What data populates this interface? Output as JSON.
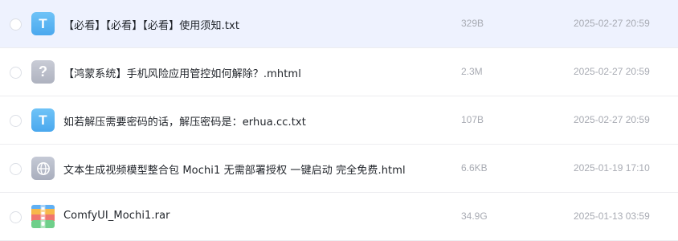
{
  "files": [
    {
      "name": "【必看】【必看】【必看】使用须知.txt",
      "size": "329B",
      "date": "2025-02-27 20:59",
      "icon": "txt-file-icon",
      "icon_glyph": "T",
      "selected": true
    },
    {
      "name": "【鸿蒙系统】手机风险应用管控如何解除？.mhtml",
      "size": "2.3M",
      "date": "2025-02-27 20:59",
      "icon": "unknown-file-icon",
      "icon_glyph": "?",
      "selected": false
    },
    {
      "name": "如若解压需要密码的话，解压密码是：erhua.cc.txt",
      "size": "107B",
      "date": "2025-02-27 20:59",
      "icon": "txt-file-icon",
      "icon_glyph": "T",
      "selected": false
    },
    {
      "name": "文本生成视频模型整合包 Mochi1 无需部署授权 一键启动 完全免费.html",
      "size": "6.6KB",
      "date": "2025-01-19 17:10",
      "icon": "html-file-icon",
      "icon_glyph": "",
      "selected": false
    },
    {
      "name": "ComfyUI_Mochi1.rar",
      "size": "34.9G",
      "date": "2025-01-13 03:59",
      "icon": "rar-archive-icon",
      "icon_glyph": "",
      "selected": false
    }
  ]
}
